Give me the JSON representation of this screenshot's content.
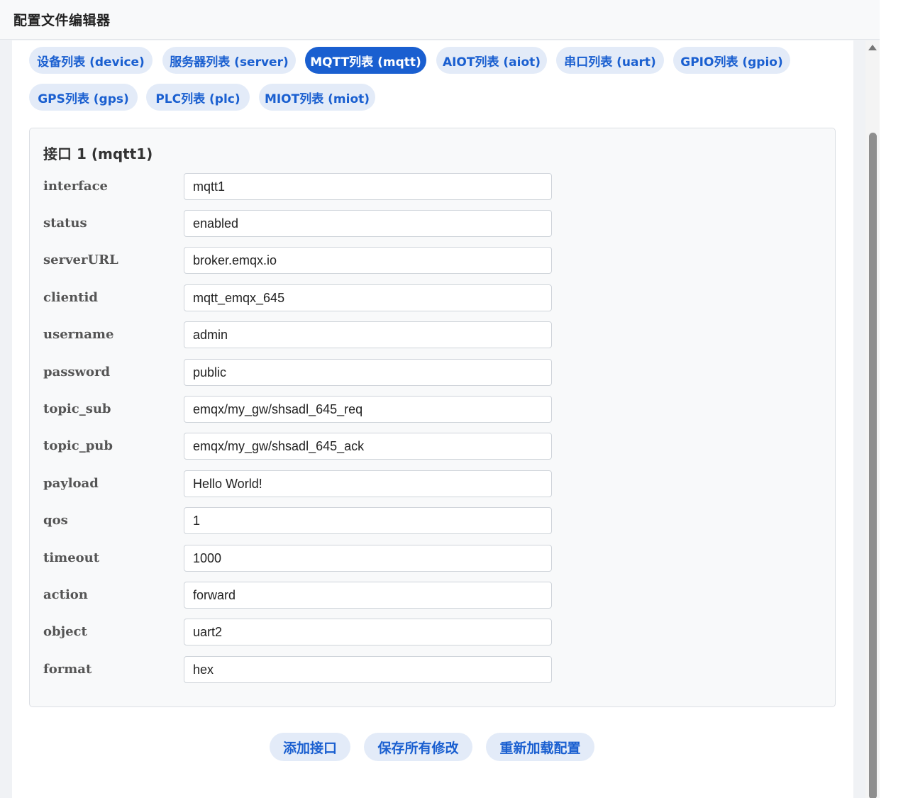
{
  "window": {
    "title": "配置文件编辑器"
  },
  "tabs": [
    {
      "label": "设备列表 (device)",
      "active": false
    },
    {
      "label": "服务器列表 (server)",
      "active": false
    },
    {
      "label": "MQTT列表 (mqtt)",
      "active": true
    },
    {
      "label": "AIOT列表 (aiot)",
      "active": false
    },
    {
      "label": "串口列表 (uart)",
      "active": false
    },
    {
      "label": "GPIO列表 (gpio)",
      "active": false
    },
    {
      "label": "GPS列表 (gps)",
      "active": false
    },
    {
      "label": "PLC列表 (plc)",
      "active": false
    },
    {
      "label": "MIOT列表 (miot)",
      "active": false
    }
  ],
  "interface_card": {
    "title": "接口 1 (mqtt1)",
    "fields": [
      {
        "label": "interface",
        "value": "mqtt1"
      },
      {
        "label": "status",
        "value": "enabled"
      },
      {
        "label": "serverURL",
        "value": "broker.emqx.io"
      },
      {
        "label": "clientid",
        "value": "mqtt_emqx_645"
      },
      {
        "label": "username",
        "value": "admin"
      },
      {
        "label": "password",
        "value": "public"
      },
      {
        "label": "topic_sub",
        "value": "emqx/my_gw/shsadl_645_req"
      },
      {
        "label": "topic_pub",
        "value": "emqx/my_gw/shsadl_645_ack"
      },
      {
        "label": "payload",
        "value": "Hello World!"
      },
      {
        "label": "qos",
        "value": "1"
      },
      {
        "label": "timeout",
        "value": "1000"
      },
      {
        "label": "action",
        "value": "forward"
      },
      {
        "label": "object",
        "value": "uart2"
      },
      {
        "label": "format",
        "value": "hex"
      }
    ]
  },
  "actions": {
    "add_label": "添加接口",
    "save_label": "保存所有修改",
    "reload_label": "重新加载配置"
  },
  "colors": {
    "accent": "#1a5fd0",
    "tab_bg": "#e3ebf8"
  }
}
